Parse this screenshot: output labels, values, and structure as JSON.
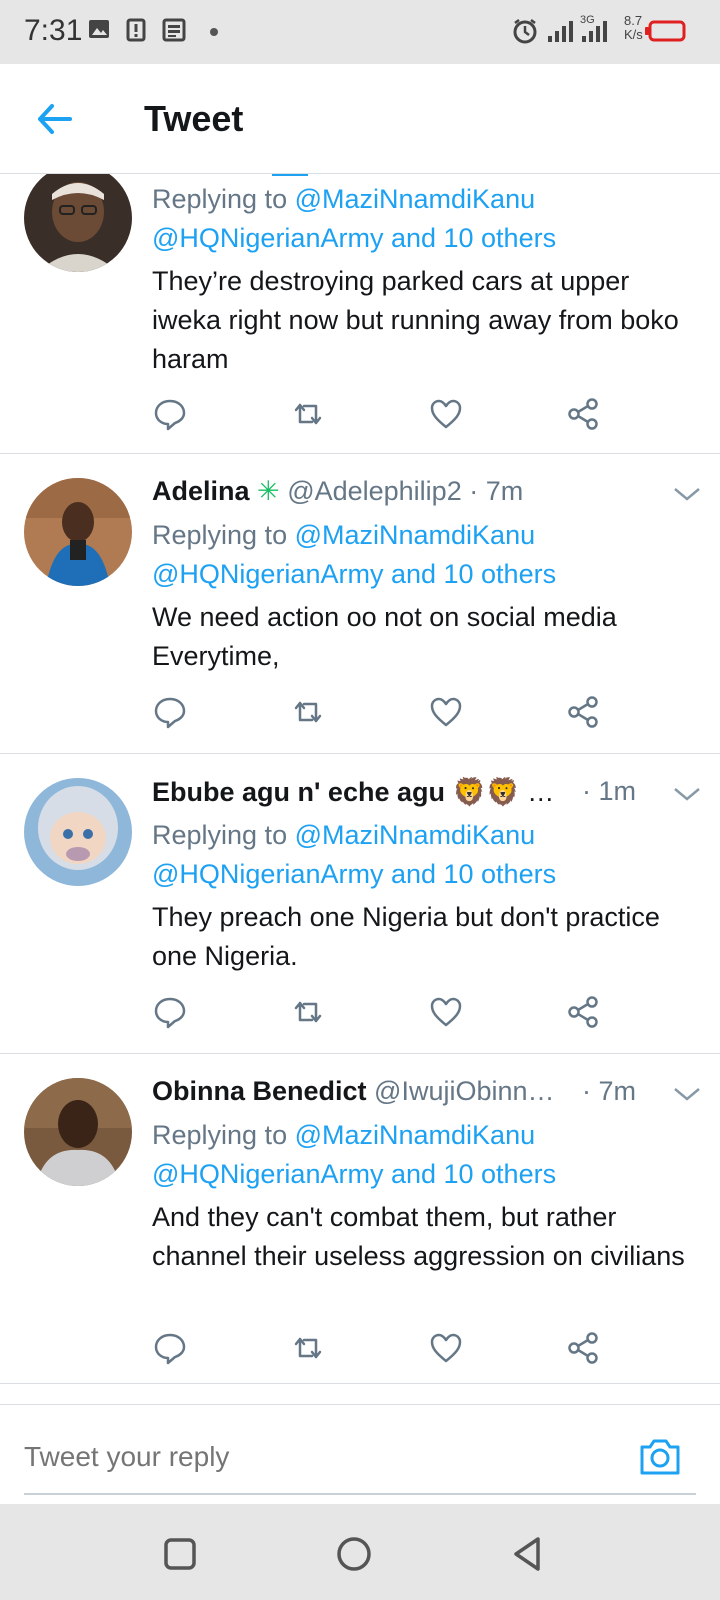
{
  "status_bar": {
    "time": "7:31",
    "network": "3G",
    "speed_value": "8.7",
    "speed_unit": "K/s",
    "icons": [
      "image-icon",
      "alert-icon",
      "news-icon",
      "alarm-icon",
      "signal-icon",
      "signal-3g-icon",
      "battery-icon"
    ]
  },
  "header": {
    "title": "Tweet",
    "back_icon": "back-arrow-icon"
  },
  "tweets": [
    {
      "name": "",
      "handle": "",
      "time": "",
      "replying_prefix": "Replying to ",
      "replying_to": "@MaziNnamdiKanu",
      "replying_more": "@HQNigerianArmy and 10 others",
      "text": "They’re destroying parked cars at upper iweka right now but running away from boko haram"
    },
    {
      "name": "Adelina",
      "name_emoji": "✳",
      "handle": "@Adelephilip2",
      "time": "· 7m",
      "replying_prefix": "Replying to ",
      "replying_to": "@MaziNnamdiKanu",
      "replying_more": "@HQNigerianArmy and 10 others",
      "text": "We need action oo not on social media Everytime,"
    },
    {
      "name": "Ebube agu n' eche agu",
      "name_emoji": "🦁🦁 …",
      "handle": "",
      "time": "· 1m",
      "replying_prefix": "Replying to ",
      "replying_to": "@MaziNnamdiKanu",
      "replying_more": "@HQNigerianArmy and 10 others",
      "text": "They preach one Nigeria but don't practice one Nigeria."
    },
    {
      "name": "Obinna Benedict",
      "name_emoji": "",
      "handle": "@IwujiObinn…",
      "time": "· 7m",
      "replying_prefix": "Replying to ",
      "replying_to": "@MaziNnamdiKanu",
      "replying_more": "@HQNigerianArmy and 10 others",
      "text": "And they can't combat them, but rather channel their useless aggression on civilians"
    }
  ],
  "reply_bar": {
    "placeholder": "Tweet your reply",
    "camera_icon": "camera-icon"
  },
  "colors": {
    "accent": "#1da1f2",
    "text": "#14171a",
    "secondary": "#657786",
    "divider": "#dadde1",
    "system_bar": "#e6e6e6",
    "battery_low": "#e02020",
    "verified_green": "#17bf63"
  }
}
